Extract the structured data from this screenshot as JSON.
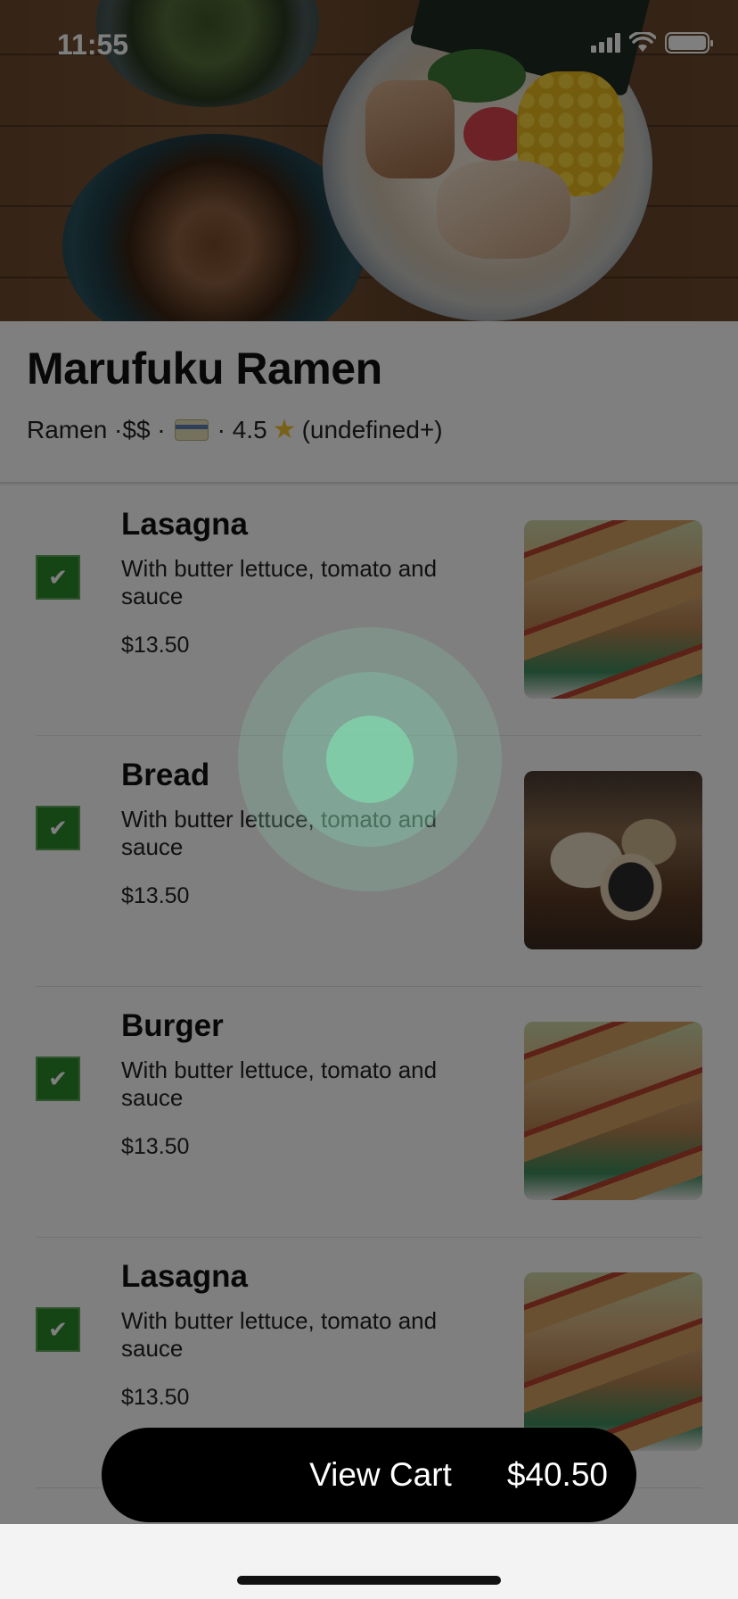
{
  "status_bar": {
    "time": "11:55"
  },
  "restaurant": {
    "name": "Marufuku Ramen",
    "subtitle_prefix": "Ramen ·$$ · ",
    "subtitle_mid": " · 4.5 ",
    "subtitle_suffix": "(undefined+)"
  },
  "menu_items": [
    {
      "title": "Lasagna",
      "description": "With butter lettuce, tomato and sauce",
      "price": "$13.50",
      "checked": true,
      "image_icon": "hotdog-image"
    },
    {
      "title": "Bread",
      "description": "With butter lettuce, tomato and sauce",
      "price": "$13.50",
      "checked": true,
      "image_icon": "bread-image"
    },
    {
      "title": "Burger",
      "description": "With butter lettuce, tomato and sauce",
      "price": "$13.50",
      "checked": true,
      "image_icon": "hotdog-image"
    },
    {
      "title": "Lasagna",
      "description": "With butter lettuce, tomato and sauce",
      "price": "$13.50",
      "checked": true,
      "image_icon": "hotdog-image"
    }
  ],
  "cart": {
    "label": "View Cart",
    "total": "$40.50"
  },
  "colors": {
    "checkbox": "#2d8a2b",
    "cart_button": "#000000",
    "touch_indicator": "#82d7af"
  }
}
